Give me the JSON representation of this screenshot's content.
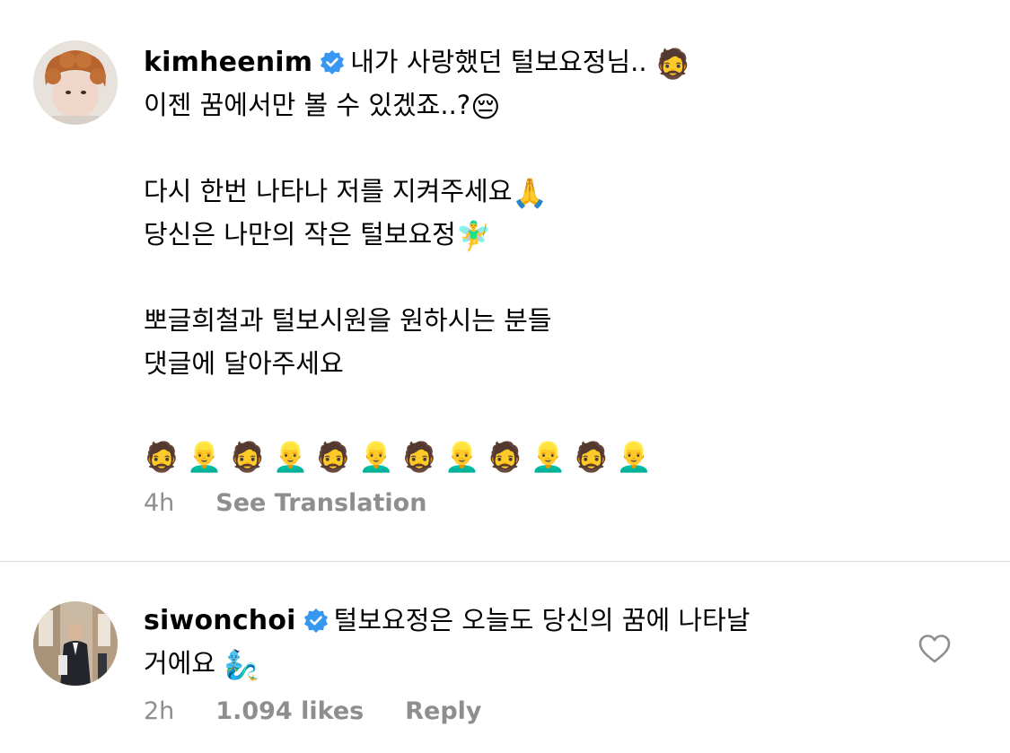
{
  "comments": [
    {
      "username": "kimheenim",
      "lines": [
        "내가 사랑했던 털보요정님..",
        "이젠 꿈에서만 볼 수 있겠죠..?",
        "",
        "다시 한번 나타나 저를 지켜주세요",
        "당신은 나만의 작은 털보요정",
        "",
        "뽀글희철과 털보시원을 원하시는 분들",
        "댓글에 달아주세요",
        ""
      ],
      "emojis": {
        "line1": "🧔",
        "line2": "😔",
        "line4": "🙏",
        "line5": "🧚‍♂️",
        "row": "🧔👱‍♂️🧔👱‍♂️🧔👱‍♂️🧔👱‍♂️🧔👱‍♂️🧔👱‍♂️"
      },
      "time": "4h",
      "translation_label": "See Translation"
    },
    {
      "username": "siwonchoi",
      "lines": [
        "털보요정은 오늘도 당신의 꿈에 나타날",
        "거에요"
      ],
      "emojis": {
        "line2": "🧞‍♂️"
      },
      "time": "2h",
      "likes": "1.094 likes",
      "reply_label": "Reply"
    }
  ],
  "icons": {
    "verified": "verified-badge-icon",
    "like": "heart-outline-icon"
  },
  "colors": {
    "verified": "#3897f0",
    "muted": "#8e8e8e",
    "divider": "#dbdbdb"
  }
}
